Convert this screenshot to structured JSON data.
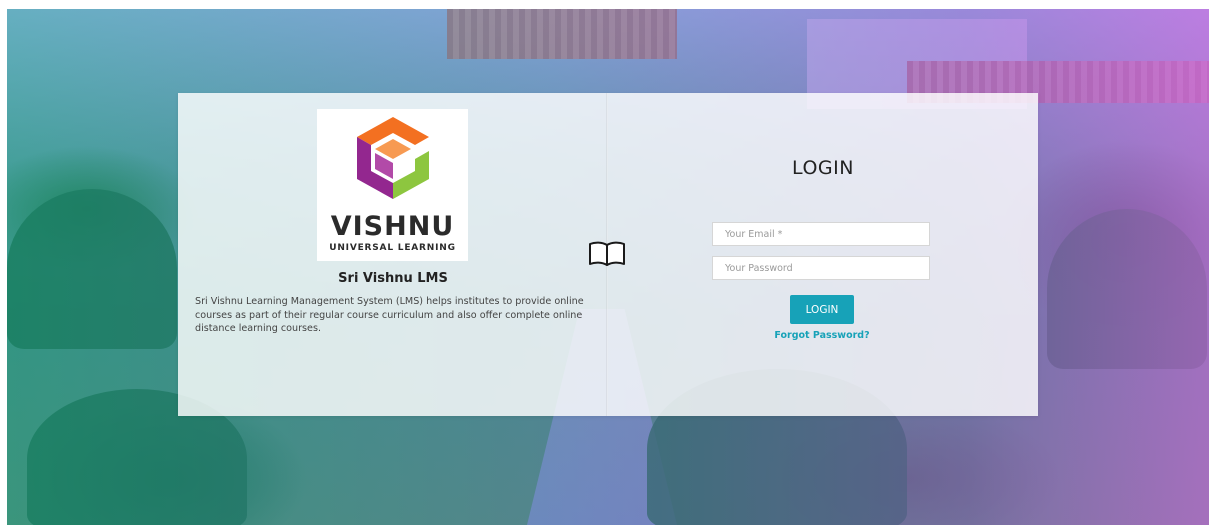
{
  "colors": {
    "accent": "#17a2b8",
    "logo_orange": "#f37021",
    "logo_purple": "#93278f",
    "logo_green": "#8dc63f"
  },
  "brand": {
    "logo_word": "VISHNU",
    "logo_subtitle": "UNIVERSAL LEARNING",
    "title": "Sri Vishnu LMS",
    "description": "Sri Vishnu Learning Management System (LMS) helps institutes to provide online courses as part of their regular course curriculum and also offer complete online distance learning courses."
  },
  "divider_icon": "open-book-icon",
  "login": {
    "title": "LOGIN",
    "email_placeholder": "Your Email *",
    "email_value": "",
    "password_placeholder": "Your Password",
    "password_value": "",
    "button_label": "LOGIN",
    "forgot_label": "Forgot Password?"
  }
}
